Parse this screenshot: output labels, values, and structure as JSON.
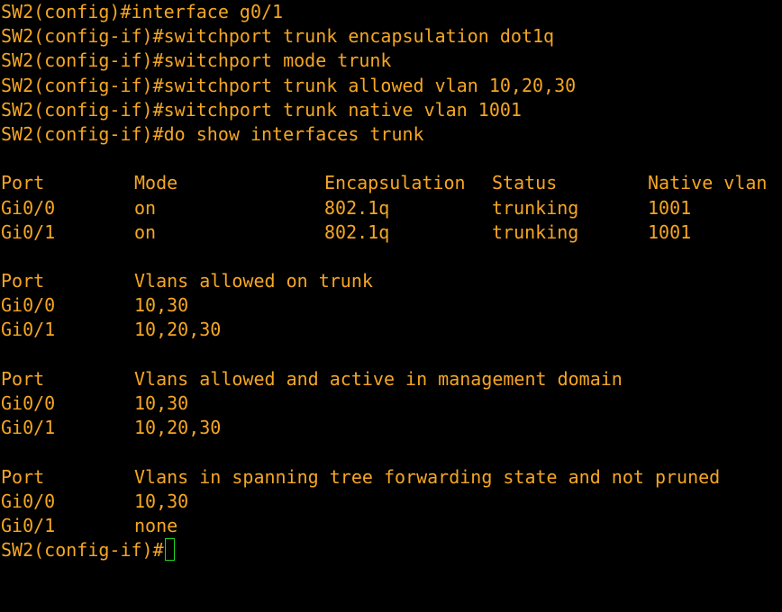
{
  "commands": [
    "SW2(config)#interface g0/1",
    "SW2(config-if)#switchport trunk encapsulation dot1q",
    "SW2(config-if)#switchport mode trunk",
    "SW2(config-if)#switchport trunk allowed vlan 10,20,30",
    "SW2(config-if)#switchport trunk native vlan 1001",
    "SW2(config-if)#do show interfaces trunk"
  ],
  "trunk_table": {
    "headers": [
      "Port",
      "Mode",
      "Encapsulation",
      "Status",
      "Native vlan"
    ],
    "rows": [
      [
        "Gi0/0",
        "on",
        "802.1q",
        "trunking",
        "1001"
      ],
      [
        "Gi0/1",
        "on",
        "802.1q",
        "trunking",
        "1001"
      ]
    ]
  },
  "sections": [
    {
      "header": [
        "Port",
        "Vlans allowed on trunk"
      ],
      "rows": [
        [
          "Gi0/0",
          "10,30"
        ],
        [
          "Gi0/1",
          "10,20,30"
        ]
      ]
    },
    {
      "header": [
        "Port",
        "Vlans allowed and active in management domain"
      ],
      "rows": [
        [
          "Gi0/0",
          "10,30"
        ],
        [
          "Gi0/1",
          "10,20,30"
        ]
      ]
    },
    {
      "header": [
        "Port",
        "Vlans in spanning tree forwarding state and not pruned"
      ],
      "rows": [
        [
          "Gi0/0",
          "10,30"
        ],
        [
          "Gi0/1",
          "none"
        ]
      ]
    }
  ],
  "prompt": "SW2(config-if)#",
  "colors": {
    "background": "#000000",
    "text": "#f5a623",
    "cursor": "#1fd81f"
  },
  "icons": {
    "cursor": "block-cursor"
  }
}
